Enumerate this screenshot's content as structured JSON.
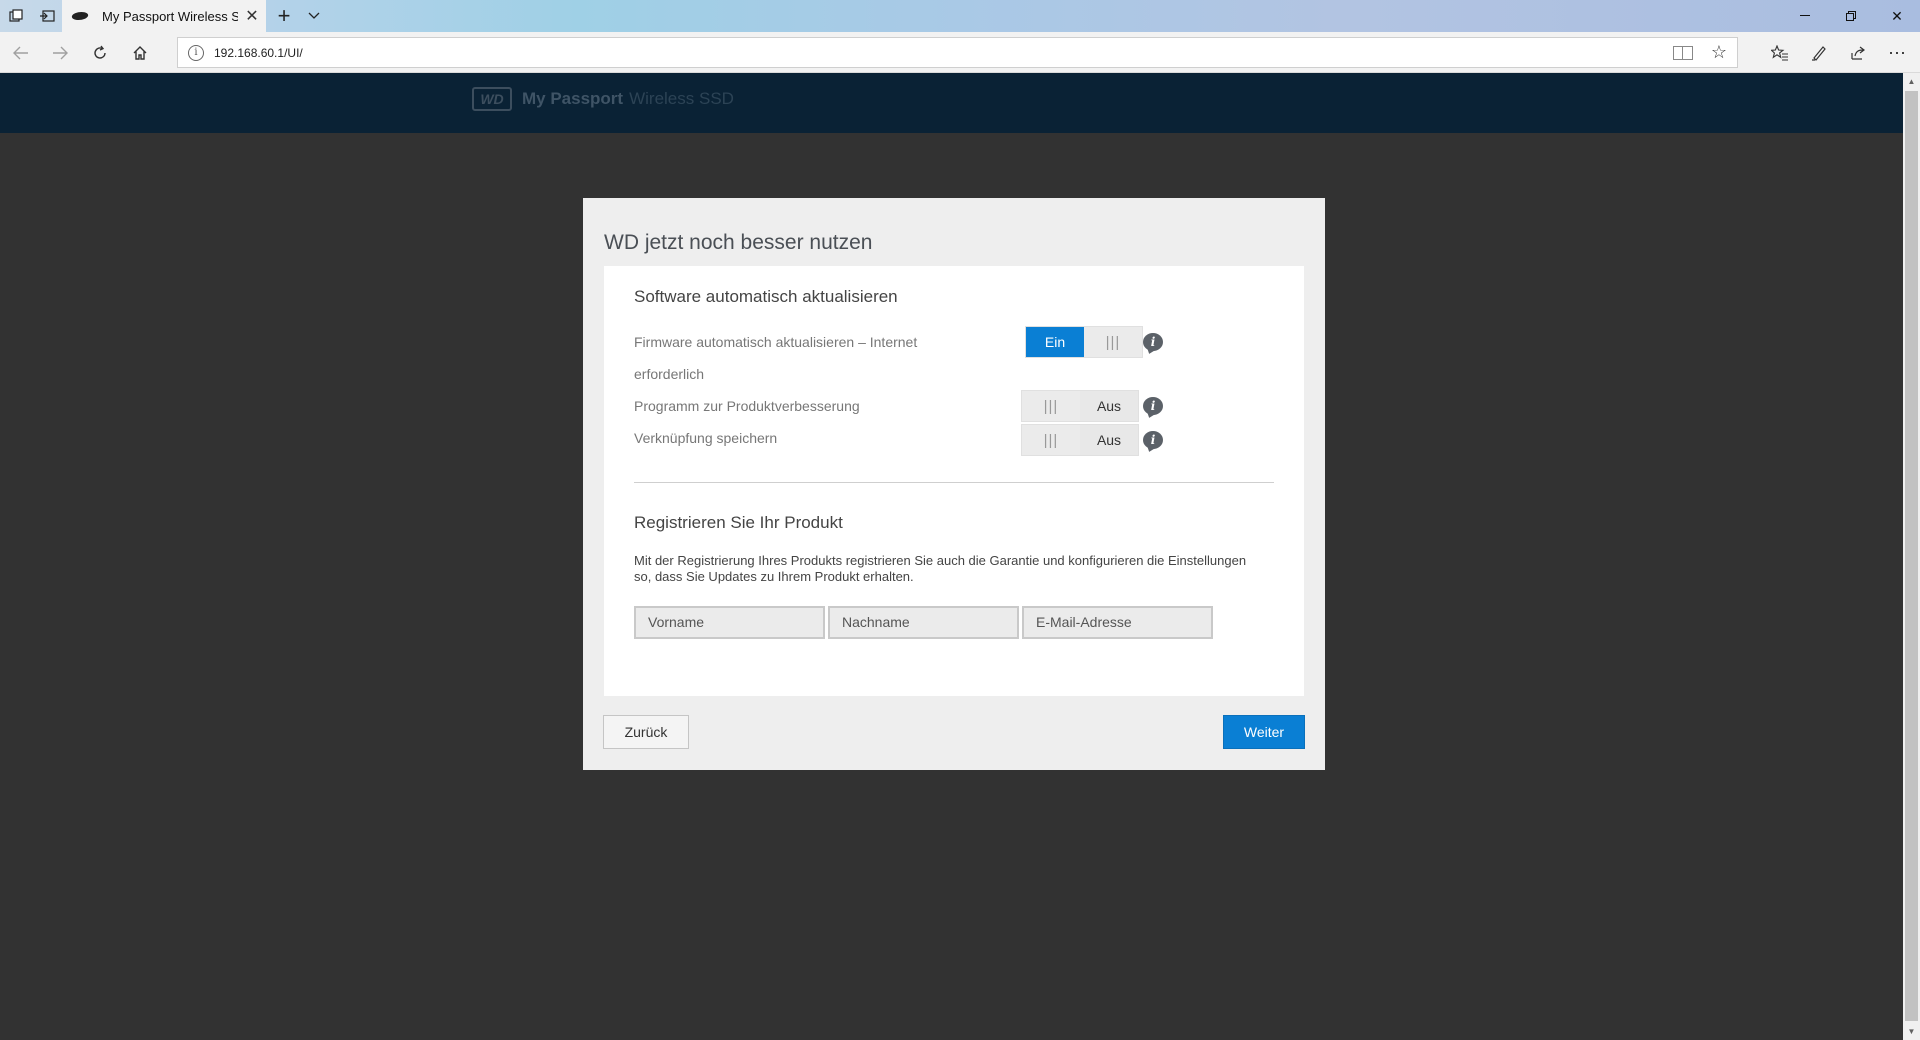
{
  "browser": {
    "tab_title": "My Passport Wireless S:",
    "url": "192.168.60.1/UI/"
  },
  "app": {
    "brand_logo": "WD",
    "brand_name": "My Passport",
    "brand_model": "Wireless SSD"
  },
  "dialog": {
    "title": "WD jetzt noch besser nutzen",
    "software_section": {
      "title": "Software automatisch aktualisieren",
      "settings": [
        {
          "label_line1": "Firmware automatisch aktualisieren – Internet",
          "label_line2": "erforderlich",
          "state": "Ein"
        },
        {
          "label": "Programm zur Produktverbesserung",
          "state": "Aus"
        },
        {
          "label": "Verknüpfung speichern",
          "state": "Aus"
        }
      ]
    },
    "register_section": {
      "title": "Registrieren Sie Ihr Produkt",
      "description": "Mit der Registrierung Ihres Produkts registrieren Sie auch die Garantie und konfigurieren die Einstellungen so, dass Sie Updates zu Ihrem Produkt erhalten.",
      "first_name_placeholder": "Vorname",
      "last_name_placeholder": "Nachname",
      "email_placeholder": "E-Mail-Adresse"
    },
    "back_label": "Zurück",
    "next_label": "Weiter"
  },
  "colors": {
    "accent": "#0a7fd4",
    "header_bg": "#0a2235",
    "page_bg": "#323232"
  }
}
